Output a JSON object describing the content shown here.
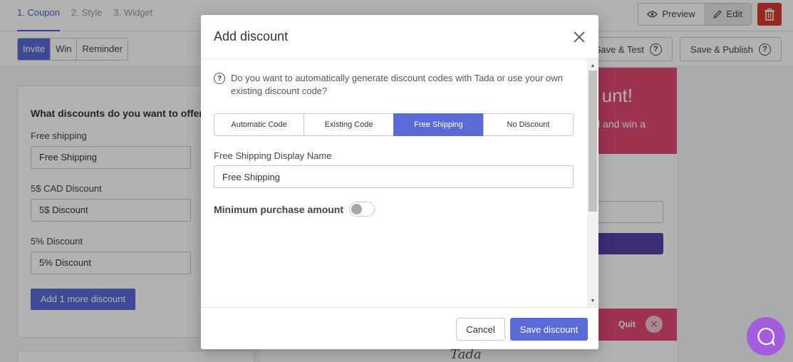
{
  "colors": {
    "accent": "#5a6ad6",
    "danger": "#d63b2f",
    "pink": "#e24a73",
    "chat": "#a45ddb"
  },
  "topbar": {
    "steps": [
      "1. Coupon",
      "2. Style",
      "3. Widget"
    ],
    "preview_label": "Preview",
    "edit_label": "Edit"
  },
  "subbar": {
    "tabs": [
      "Invite",
      "Win",
      "Reminder"
    ],
    "save_test_label": "Save & Test",
    "save_publish_label": "Save & Publish"
  },
  "left_panel": {
    "heading": "What discounts do you want to offer?",
    "discounts": [
      {
        "label": "Free shipping",
        "value": "Free Shipping"
      },
      {
        "label": "5$ CAD Discount",
        "value": "5$ Discount"
      },
      {
        "label": "5% Discount",
        "value": "5% Discount"
      }
    ],
    "add_more_label": "Add 1 more discount"
  },
  "preview": {
    "headline": "unt!",
    "subtext": "l and win a",
    "quit_label": "Quit",
    "brand": "Tada"
  },
  "modal": {
    "title": "Add discount",
    "help_text": "Do you want to automatically generate discount codes with Tada or use your own existing discount code?",
    "code_tabs": [
      "Automatic Code",
      "Existing Code",
      "Free Shipping",
      "No Discount"
    ],
    "active_tab": "Free Shipping",
    "display_name_label": "Free Shipping Display Name",
    "display_name_value": "Free Shipping",
    "min_purchase_label": "Minimum purchase amount",
    "min_purchase_enabled": false,
    "cancel_label": "Cancel",
    "save_label": "Save discount"
  }
}
